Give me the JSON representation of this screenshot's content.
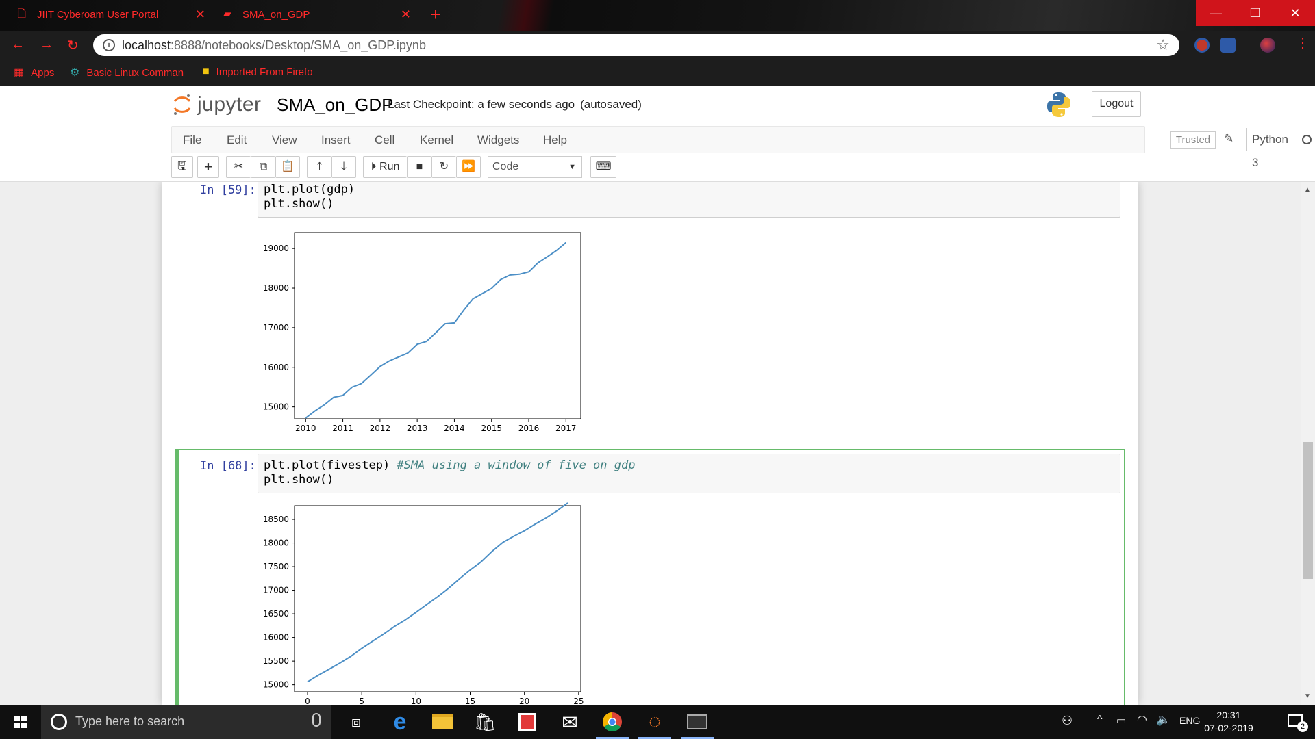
{
  "browser": {
    "tabs": [
      {
        "title": "JIIT Cyberoam User Portal",
        "close": "✕"
      },
      {
        "title": "SMA_on_GDP",
        "close": "✕"
      }
    ],
    "new_tab": "+",
    "url_host": "localhost",
    "url_path": ":8888/notebooks/Desktop/SMA_on_GDP.ipynb",
    "bookmarks": [
      "Apps",
      "Basic Linux Comman",
      "Imported From Firefo"
    ],
    "window_controls": {
      "minimize": "—",
      "maximize": "❐",
      "close": "✕"
    }
  },
  "jupyter": {
    "logo_text": "jupyter",
    "notebook_name": "SMA_on_GDP",
    "checkpoint": "Last Checkpoint: a few seconds ago",
    "autosave": "(autosaved)",
    "logout": "Logout",
    "menus": [
      "File",
      "Edit",
      "View",
      "Insert",
      "Cell",
      "Kernel",
      "Widgets",
      "Help"
    ],
    "trusted": "Trusted",
    "kernel": "Python 3",
    "run_label": "Run",
    "cell_type": "Code",
    "toolbar_icons": [
      "save-icon",
      "plus-icon",
      "cut-icon",
      "copy-icon",
      "paste-icon",
      "arrow-up-icon",
      "arrow-down-icon",
      "run-icon",
      "stop-icon",
      "restart-icon",
      "fast-forward-icon",
      "keyboard-icon"
    ]
  },
  "cells": [
    {
      "prompt": "In [59]:",
      "code_line1": "plt.plot(gdp)",
      "code_line2": "plt.show()"
    },
    {
      "prompt": "In [68]:",
      "code_line1": "plt.plot(fivestep) ",
      "comment": "#SMA using a window of five on gdp",
      "code_line2": "plt.show()"
    }
  ],
  "chart_data": [
    {
      "type": "line",
      "title": "",
      "xlabel": "",
      "ylabel": "",
      "xlim": [
        2009.7,
        2017.4
      ],
      "ylim": [
        14700,
        19400
      ],
      "xticks": [
        2010,
        2011,
        2012,
        2013,
        2014,
        2015,
        2016,
        2017
      ],
      "yticks": [
        15000,
        16000,
        17000,
        18000,
        19000
      ],
      "series": [
        {
          "x": [
            2010.0,
            2010.25,
            2010.5,
            2010.75,
            2011.0,
            2011.25,
            2011.5,
            2011.75,
            2012.0,
            2012.25,
            2012.5,
            2012.75,
            2013.0,
            2013.25,
            2013.5,
            2013.75,
            2014.0,
            2014.25,
            2014.5,
            2014.75,
            2015.0,
            2015.25,
            2015.5,
            2015.75,
            2016.0,
            2016.25,
            2016.5,
            2016.75,
            2017.0
          ],
          "values": [
            14720,
            14900,
            15050,
            15240,
            15290,
            15500,
            15590,
            15800,
            16020,
            16160,
            16260,
            16360,
            16580,
            16650,
            16870,
            17100,
            17120,
            17440,
            17730,
            17860,
            17990,
            18220,
            18330,
            18350,
            18410,
            18640,
            18790,
            18950,
            19150
          ],
          "color": "#4c8fc6"
        }
      ],
      "grid": false
    },
    {
      "type": "line",
      "title": "",
      "xlabel": "",
      "ylabel": "",
      "xlim": [
        -1.2,
        25.2
      ],
      "ylim": [
        14850,
        18790
      ],
      "xticks": [
        0,
        5,
        10,
        15,
        20,
        25
      ],
      "yticks": [
        15000,
        15500,
        16000,
        16500,
        17000,
        17500,
        18000,
        18500
      ],
      "series": [
        {
          "x": [
            0,
            1,
            2,
            3,
            4,
            5,
            6,
            7,
            8,
            9,
            10,
            11,
            12,
            13,
            14,
            15,
            16,
            17,
            18,
            19,
            20,
            21,
            22,
            23,
            24
          ],
          "values": [
            15060,
            15200,
            15330,
            15460,
            15600,
            15770,
            15920,
            16070,
            16230,
            16370,
            16530,
            16700,
            16860,
            17040,
            17240,
            17430,
            17600,
            17820,
            18010,
            18140,
            18260,
            18400,
            18530,
            18680,
            18850
          ],
          "color": "#4c8fc6"
        }
      ],
      "grid": false
    }
  ],
  "taskbar": {
    "search_placeholder": "Type here to search",
    "language": "ENG",
    "time": "20:31",
    "date": "07-02-2019",
    "notifications": "2"
  }
}
